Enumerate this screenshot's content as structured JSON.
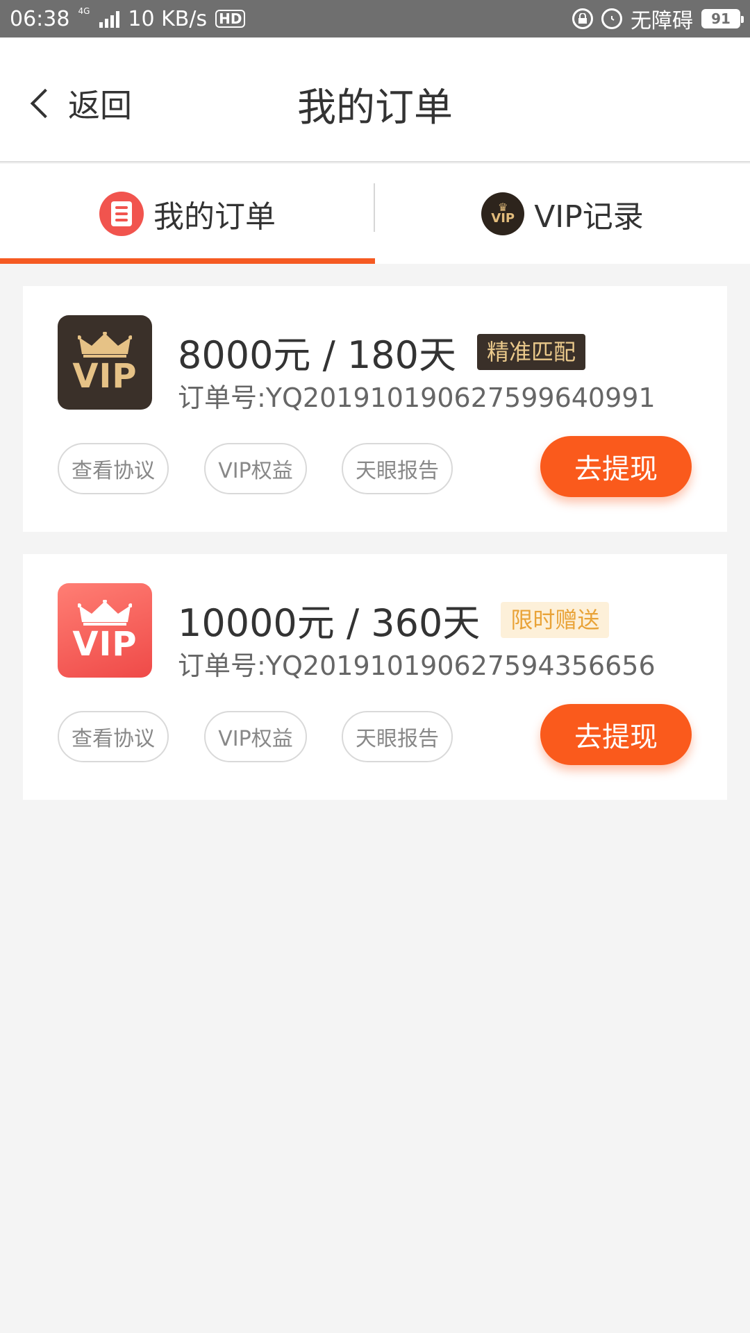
{
  "status_bar": {
    "time": "06:38",
    "network": "4G",
    "speed": "10 KB/s",
    "hd": "HD",
    "accessibility": "无障碍",
    "battery": "91"
  },
  "header": {
    "back_label": "返回",
    "title": "我的订单"
  },
  "tabs": [
    {
      "label": "我的订单",
      "active": true,
      "icon": "document-icon"
    },
    {
      "label": "VIP记录",
      "active": false,
      "icon": "vip-crown-icon"
    }
  ],
  "orders": [
    {
      "badge_text": "VIP",
      "badge_style": "dark",
      "title": "8000元 / 180天",
      "tag": "精准匹配",
      "order_no": "订单号:YQ201910190627599640991",
      "actions": [
        "查看协议",
        "VIP权益",
        "天眼报告"
      ],
      "cta": "去提现"
    },
    {
      "badge_text": "VIP",
      "badge_style": "red",
      "title": "10000元 / 360天",
      "tag": "限时赠送",
      "order_no": "订单号:YQ201910190627594356656",
      "actions": [
        "查看协议",
        "VIP权益",
        "天眼报告"
      ],
      "cta": "去提现"
    }
  ],
  "colors": {
    "accent": "#f55a22",
    "cta": "#fa5a1c",
    "dark_badge": "#3a3029",
    "gold": "#e6c286"
  }
}
